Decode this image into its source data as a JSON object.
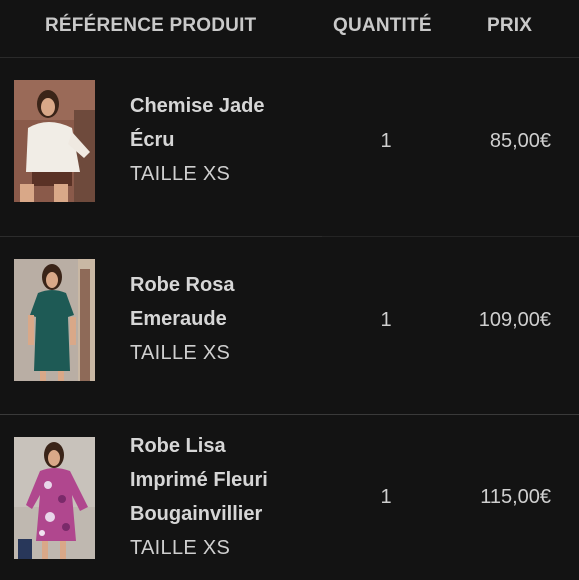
{
  "header": {
    "reference": "RÉFÉRENCE PRODUIT",
    "quantity": "QUANTITÉ",
    "price": "PRIX"
  },
  "products": [
    {
      "name_lines": [
        "Chemise Jade",
        "Écru"
      ],
      "size": "TAILLE XS",
      "quantity": "1",
      "price": "85,00€",
      "image": "model-white-blouse-photo",
      "garment_color": "#f1ede6",
      "background_color": "#8a5a4a"
    },
    {
      "name_lines": [
        "Robe Rosa",
        "Emeraude"
      ],
      "size": "TAILLE XS",
      "quantity": "1",
      "price": "109,00€",
      "image": "model-green-dress-photo",
      "garment_color": "#1e5a55",
      "background_color": "#b9aea4"
    },
    {
      "name_lines": [
        "Robe Lisa",
        "Imprimé Fleuri",
        "Bougainvillier"
      ],
      "size": "TAILLE XS",
      "quantity": "1",
      "price": "115,00€",
      "image": "model-floral-dress-photo",
      "garment_color": "#b0478e",
      "background_color": "#c8c2bb"
    }
  ]
}
